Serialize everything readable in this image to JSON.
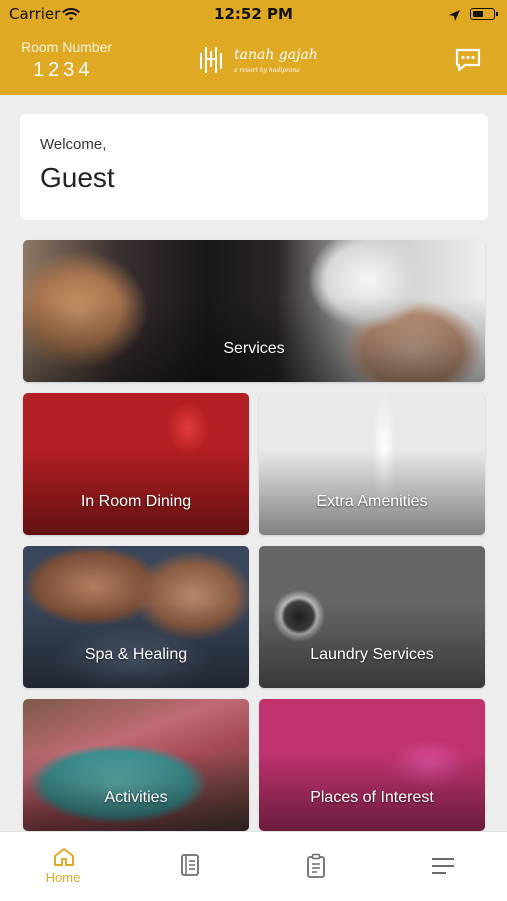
{
  "status_bar": {
    "carrier": "Carrier",
    "time": "12:52 PM",
    "icons": [
      "wifi-icon",
      "location-arrow-icon",
      "battery-icon"
    ]
  },
  "header": {
    "room_label": "Room Number",
    "room_number": "1234",
    "logo_name": "tanah gajah",
    "logo_tagline": "a resort by hadiprana",
    "chat_icon": "chat-icon",
    "background_color": "#dfa924"
  },
  "welcome": {
    "greeting": "Welcome,",
    "name": "Guest"
  },
  "tiles": [
    {
      "label": "Services"
    },
    {
      "label": "In Room Dining"
    },
    {
      "label": "Extra Amenities"
    },
    {
      "label": "Spa & Healing"
    },
    {
      "label": "Laundry Services"
    },
    {
      "label": "Activities"
    },
    {
      "label": "Places of Interest"
    }
  ],
  "bottom_nav": {
    "items": [
      {
        "label": "Home",
        "icon": "home-icon",
        "active": true
      },
      {
        "label": "",
        "icon": "menu-book-icon",
        "active": false
      },
      {
        "label": "",
        "icon": "clipboard-icon",
        "active": false
      },
      {
        "label": "",
        "icon": "hamburger-menu-icon",
        "active": false
      }
    ],
    "active_color": "#dfa924",
    "inactive_color": "#6b6b6b"
  }
}
